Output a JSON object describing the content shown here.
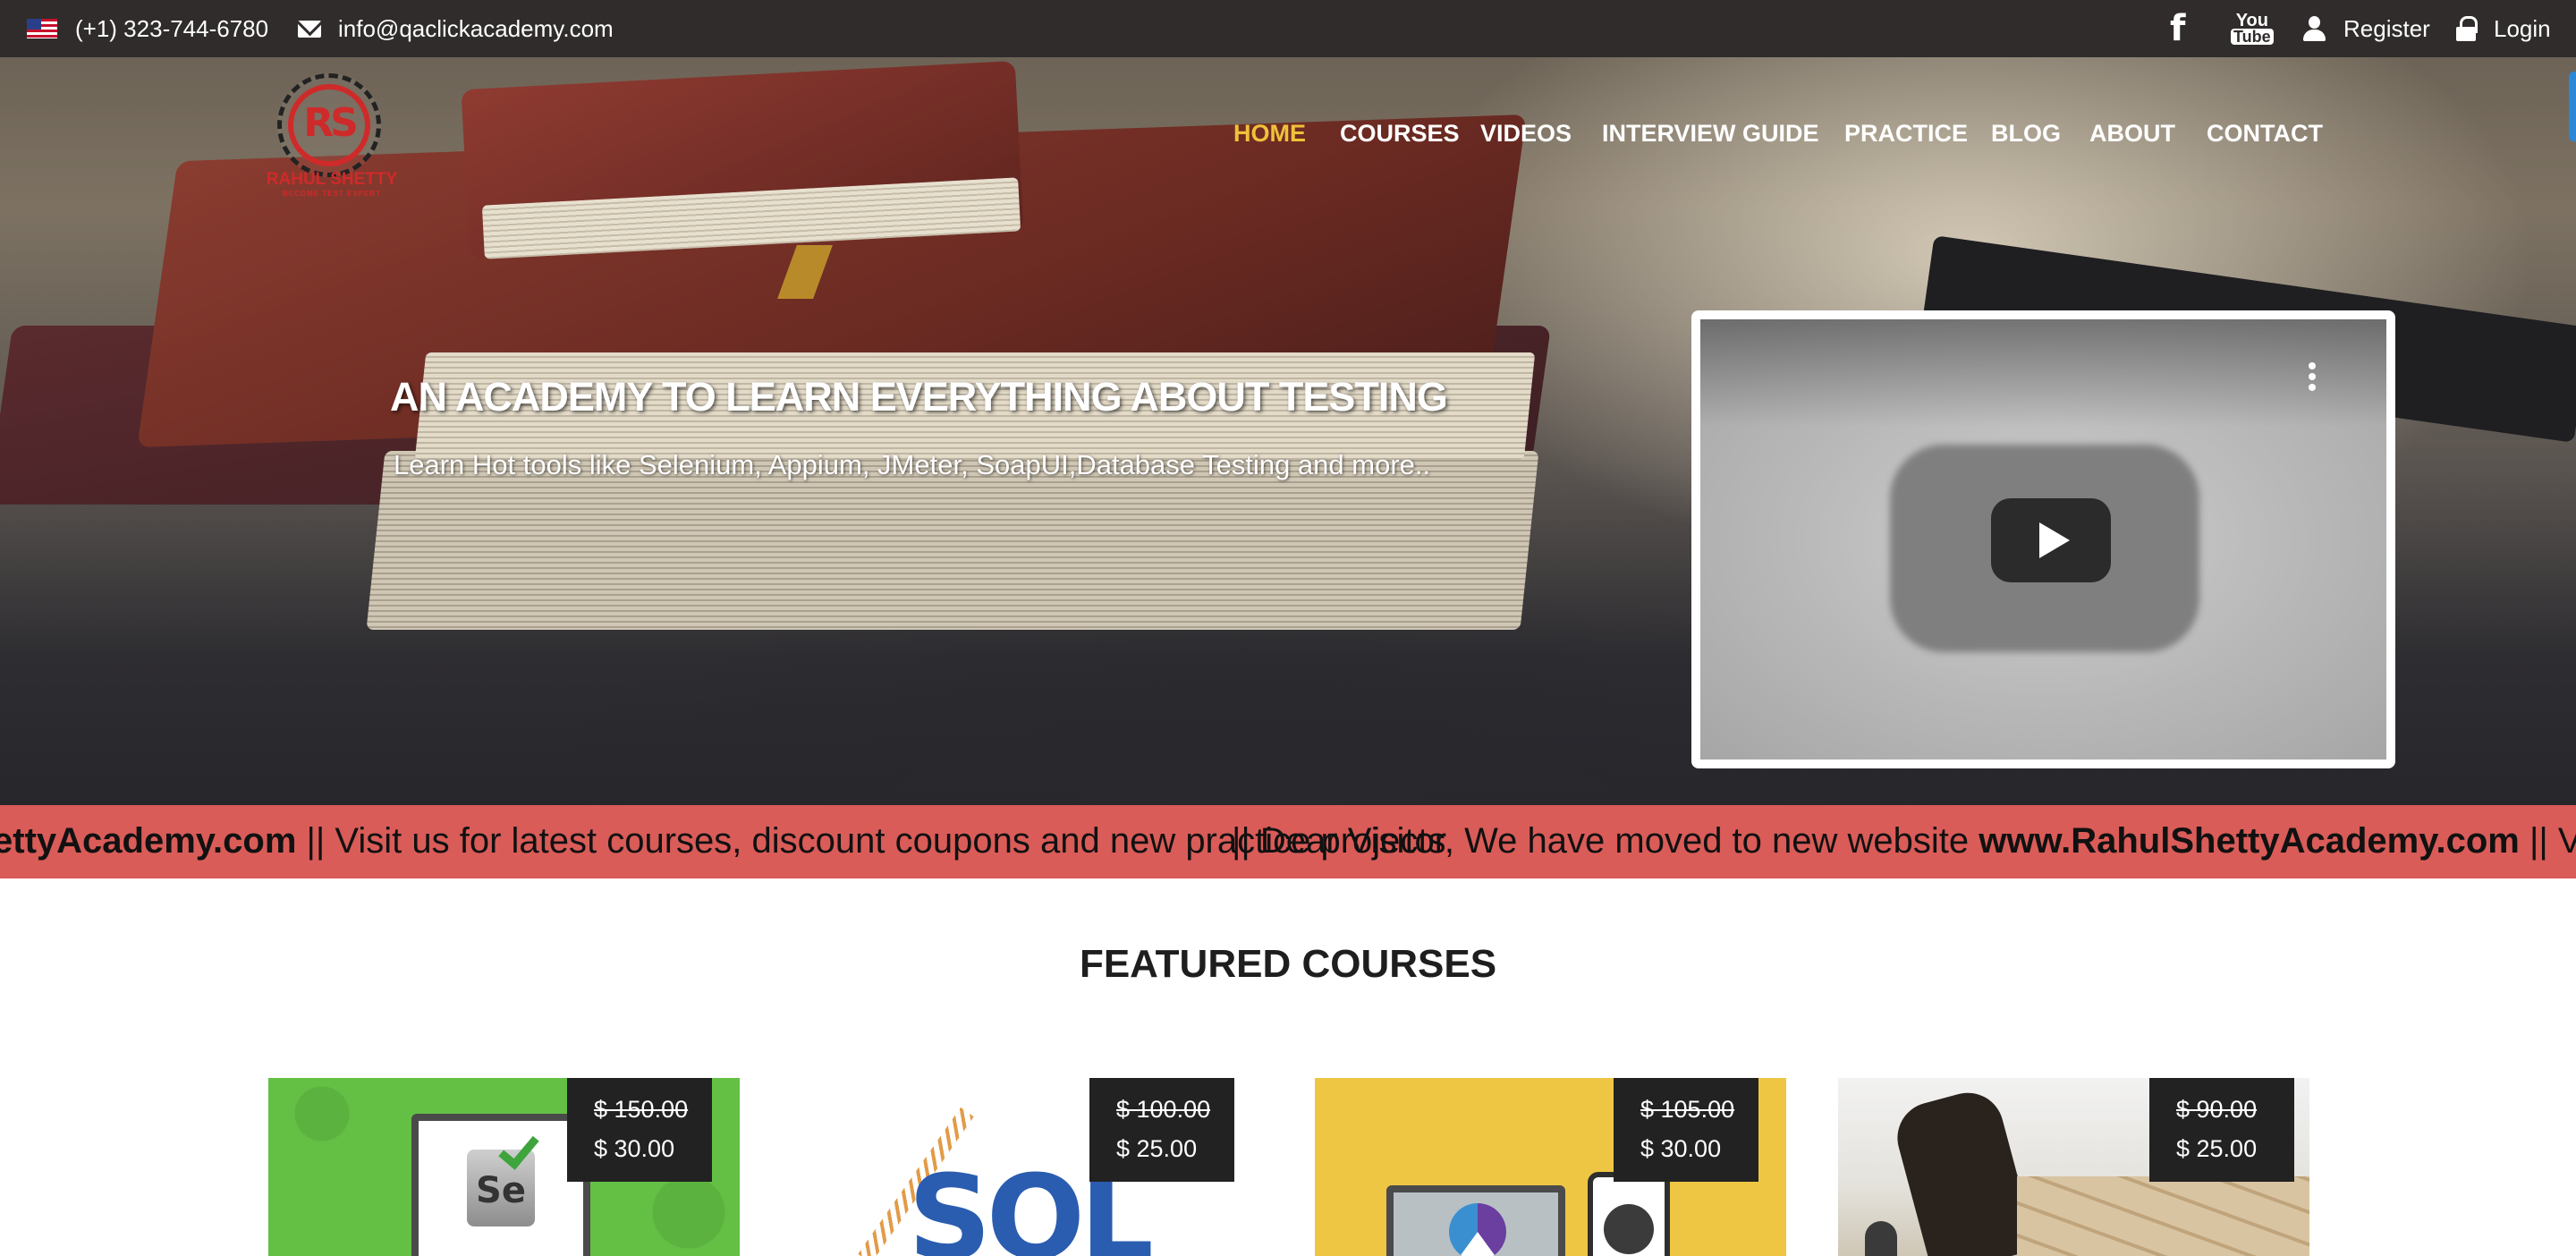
{
  "topbar": {
    "phone": "(+1) 323-744-6780",
    "email": "info@qaclickacademy.com",
    "register": "Register",
    "login": "Login",
    "icons": [
      "us-flag-icon",
      "envelope-icon",
      "facebook-icon",
      "youtube-icon",
      "user-icon",
      "lock-icon"
    ],
    "youtube_you": "You",
    "youtube_tube": "Tube",
    "facebook_letter": "f"
  },
  "logo": {
    "mark": "RS",
    "name": "RAHUL SHETTY",
    "tagline": "BECOME TEST EXPERT"
  },
  "nav": {
    "items": [
      "HOME",
      "COURSES",
      "VIDEOS",
      "INTERVIEW GUIDE",
      "PRACTICE",
      "BLOG",
      "ABOUT",
      "CONTACT"
    ],
    "active_index": 0,
    "active_color": "#f0c13a"
  },
  "hero": {
    "title": "AN ACADEMY TO LEARN EVERYTHING ABOUT TESTING",
    "subtitle": "Learn Hot tools like Selenium, Appium, JMeter, SoapUI,Database Testing and more.."
  },
  "marquee": {
    "segment_a_bold": "ettyAcademy.com",
    "segment_a_text": " || Visit us for latest courses, discount coupons and new practice projects",
    "segment_b_text": "|| Dear Visitor, We have moved to new website ",
    "segment_b_bold": "www.RahulShettyAcademy.com",
    "segment_b_tail": " || Visi",
    "background": "#d95c58"
  },
  "featured": {
    "title": "FEATURED COURSES",
    "courses": [
      {
        "old_price": "$ 150.00",
        "new_price": "$ 30.00"
      },
      {
        "old_price": "$ 100.00",
        "new_price": "$ 25.00"
      },
      {
        "old_price": "$ 105.00",
        "new_price": "$ 30.00"
      },
      {
        "old_price": "$ 90.00",
        "new_price": "$ 25.00"
      }
    ]
  },
  "course_art": {
    "c1_glyph": "Se",
    "c2_glyph": "SQL"
  }
}
